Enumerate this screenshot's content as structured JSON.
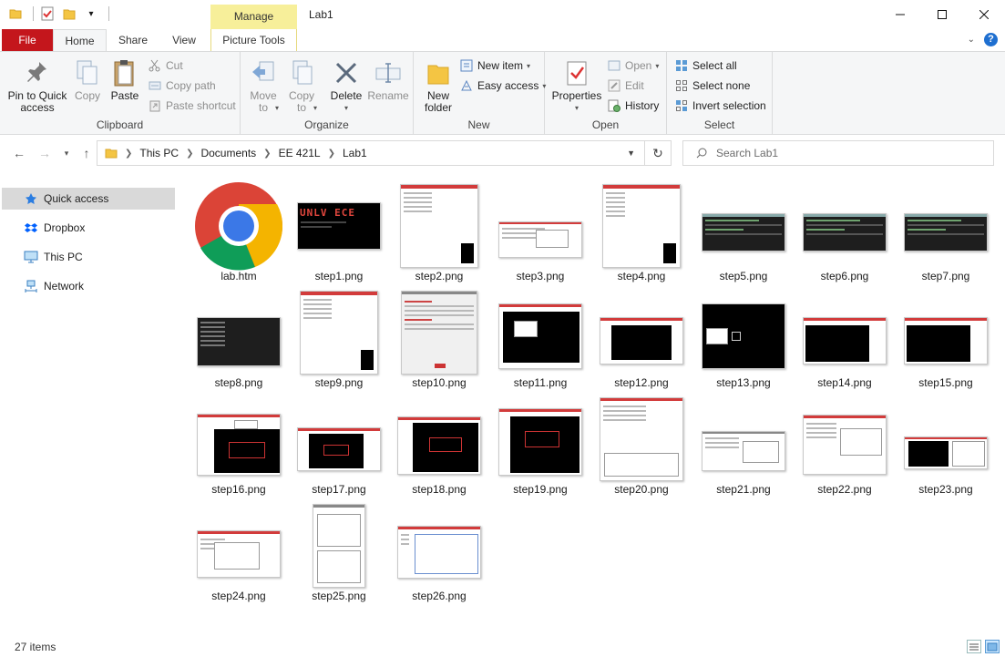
{
  "window": {
    "title": "Lab1",
    "context_tab_header": "Manage"
  },
  "tabs": {
    "file": "File",
    "home": "Home",
    "share": "Share",
    "view": "View",
    "picture_tools": "Picture Tools"
  },
  "ribbon": {
    "clipboard": {
      "label": "Clipboard",
      "pin": "Pin to Quick access",
      "copy": "Copy",
      "paste": "Paste",
      "cut": "Cut",
      "copy_path": "Copy path",
      "paste_shortcut": "Paste shortcut"
    },
    "organize": {
      "label": "Organize",
      "move_to": "Move to",
      "copy_to": "Copy to",
      "delete": "Delete",
      "rename": "Rename"
    },
    "new": {
      "label": "New",
      "new_folder": "New folder",
      "new_item": "New item",
      "easy_access": "Easy access"
    },
    "open": {
      "label": "Open",
      "properties": "Properties",
      "open": "Open",
      "edit": "Edit",
      "history": "History"
    },
    "select": {
      "label": "Select",
      "select_all": "Select all",
      "select_none": "Select none",
      "invert_selection": "Invert selection"
    }
  },
  "address": {
    "crumbs": [
      "This PC",
      "Documents",
      "EE 421L",
      "Lab1"
    ],
    "search_placeholder": "Search Lab1"
  },
  "navpane": {
    "items": [
      {
        "label": "Quick access",
        "icon": "star-icon"
      },
      {
        "label": "Dropbox",
        "icon": "dropbox-icon"
      },
      {
        "label": "This PC",
        "icon": "computer-icon"
      },
      {
        "label": "Network",
        "icon": "network-icon"
      }
    ]
  },
  "files": [
    "lab.htm",
    "step1.png",
    "step2.png",
    "step3.png",
    "step4.png",
    "step5.png",
    "step6.png",
    "step7.png",
    "step8.png",
    "step9.png",
    "step10.png",
    "step11.png",
    "step12.png",
    "step13.png",
    "step14.png",
    "step15.png",
    "step16.png",
    "step17.png",
    "step18.png",
    "step19.png",
    "step20.png",
    "step21.png",
    "step22.png",
    "step23.png",
    "step24.png",
    "step25.png",
    "step26.png"
  ],
  "thumb_text": {
    "step1": "UNLV ECE"
  },
  "status": {
    "item_count": "27 items"
  },
  "colors": {
    "file_tab": "#c4161c",
    "manage_tab": "#f7ef9a",
    "selected_nav": "#d9d9d9"
  }
}
